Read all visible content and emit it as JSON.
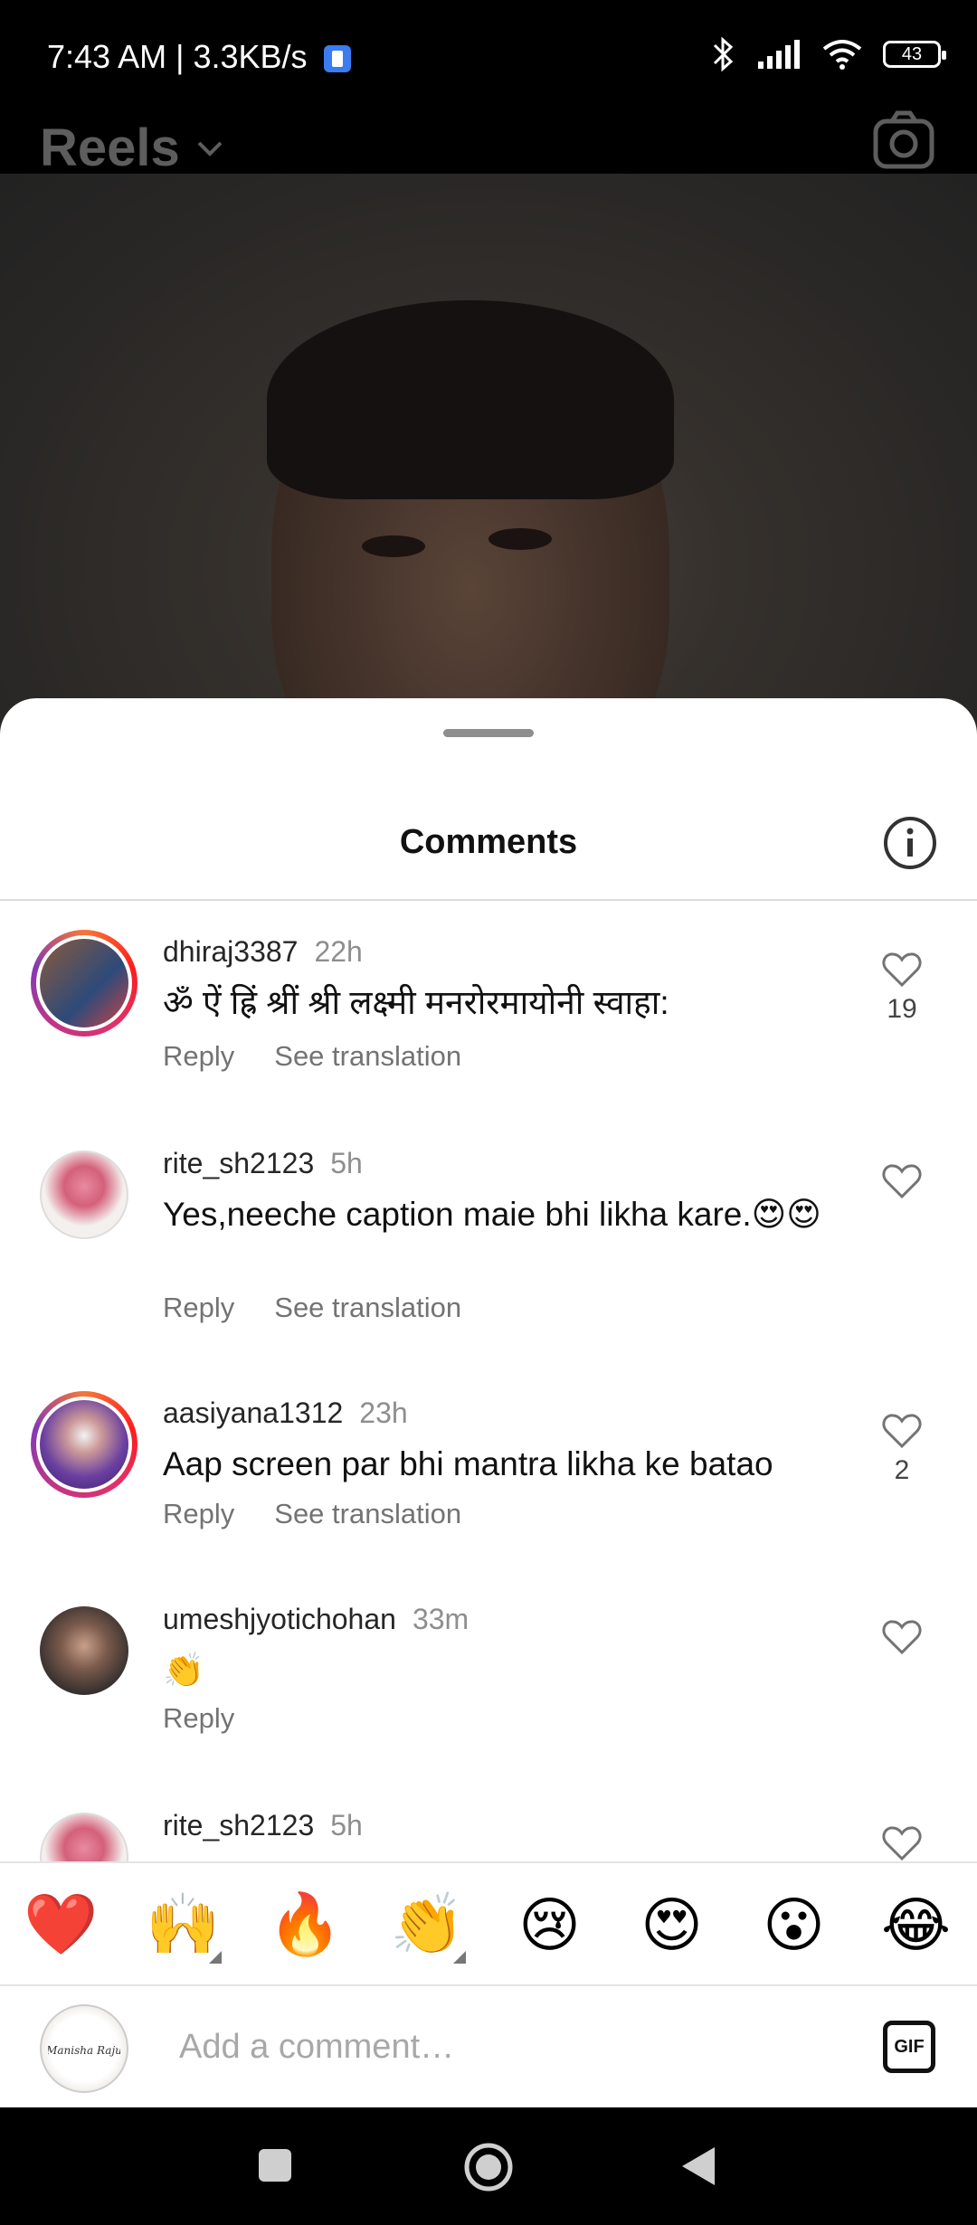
{
  "status": {
    "time": "7:43 AM | 3.3KB/s",
    "battery": "43"
  },
  "header": {
    "title": "Reels"
  },
  "sheet": {
    "title": "Comments"
  },
  "comments": [
    {
      "username": "dhiraj3387",
      "time": "22h",
      "text": "ॐ ऐं ह्रिं श्रीं श्री लक्ष्मी मनरोरमायोनी स्वाहा:",
      "reply": "Reply",
      "translation": "See translation",
      "likes": "19"
    },
    {
      "username": "rite_sh2123",
      "time": "5h",
      "text": "Yes,neeche caption maie bhi likha kare.😍😍",
      "reply": "Reply",
      "translation": "See translation",
      "likes": ""
    },
    {
      "username": "aasiyana1312",
      "time": "23h",
      "text": "Aap screen par bhi mantra likha ke batao",
      "reply": "Reply",
      "translation": "See translation",
      "likes": "2"
    },
    {
      "username": "umeshjyotichohan",
      "time": "33m",
      "text": "👏",
      "reply": "Reply",
      "translation": "",
      "likes": ""
    },
    {
      "username": "rite_sh2123",
      "time": "5h",
      "text": "",
      "reply": "",
      "translation": "",
      "likes": ""
    }
  ],
  "emoji_bar": [
    "❤️",
    "🙌",
    "🔥",
    "👏",
    "😢",
    "😍",
    "😮",
    "😂"
  ],
  "compose": {
    "placeholder": "Add a comment…",
    "avatar_text": "Manisha Raju",
    "gif_label": "GIF"
  },
  "colors": {
    "accent_ring_start": "#f77737",
    "accent_ring_end": "#833ab4",
    "heart_red": "#e0245e"
  }
}
